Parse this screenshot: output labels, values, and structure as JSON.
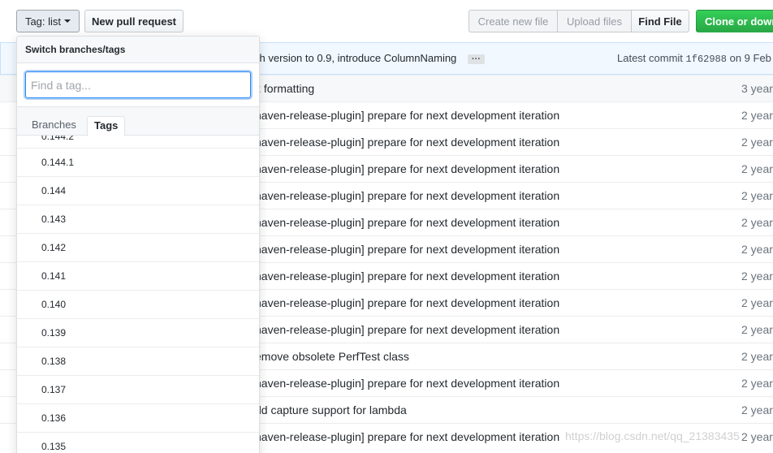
{
  "toolbar": {
    "tag_button_label": "Tag: list",
    "new_pr_label": "New pull request",
    "create_file_label": "Create new file",
    "upload_files_label": "Upload files",
    "find_file_label": "Find File",
    "clone_label": "Clone or down"
  },
  "commit_bar": {
    "message": "ch version to 0.9, introduce ColumnNaming",
    "ellipsis": "···",
    "latest_prefix": "Latest commit",
    "sha": "1f62988",
    "date": "on 9 Feb"
  },
  "files": [
    {
      "message": "x formatting",
      "age": "3 year"
    },
    {
      "message": "naven-release-plugin] prepare for next development iteration",
      "age": "2 year"
    },
    {
      "message": "naven-release-plugin] prepare for next development iteration",
      "age": "2 year"
    },
    {
      "message": "naven-release-plugin] prepare for next development iteration",
      "age": "2 year"
    },
    {
      "message": "naven-release-plugin] prepare for next development iteration",
      "age": "2 year"
    },
    {
      "message": "naven-release-plugin] prepare for next development iteration",
      "age": "2 year"
    },
    {
      "message": "naven-release-plugin] prepare for next development iteration",
      "age": "2 year"
    },
    {
      "message": "naven-release-plugin] prepare for next development iteration",
      "age": "2 year"
    },
    {
      "message": "naven-release-plugin] prepare for next development iteration",
      "age": "2 year"
    },
    {
      "message": "naven-release-plugin] prepare for next development iteration",
      "age": "2 year"
    },
    {
      "message": "emove obsolete PerfTest class",
      "age": "2 year"
    },
    {
      "message": "naven-release-plugin] prepare for next development iteration",
      "age": "2 year"
    },
    {
      "message": "dd capture support for lambda",
      "age": "2 year"
    },
    {
      "message": "naven-release-plugin] prepare for next development iteration",
      "age": "2 year"
    }
  ],
  "dropdown": {
    "header": "Switch branches/tags",
    "filter_placeholder": "Find a tag...",
    "tab_branches": "Branches",
    "tab_tags": "Tags",
    "partial_item": "0.144.2",
    "tags": [
      "0.144.1",
      "0.144",
      "0.143",
      "0.142",
      "0.141",
      "0.140",
      "0.139",
      "0.138",
      "0.137",
      "0.136",
      "0.135"
    ]
  },
  "watermark": "https://blog.csdn.net/qq_21383435"
}
